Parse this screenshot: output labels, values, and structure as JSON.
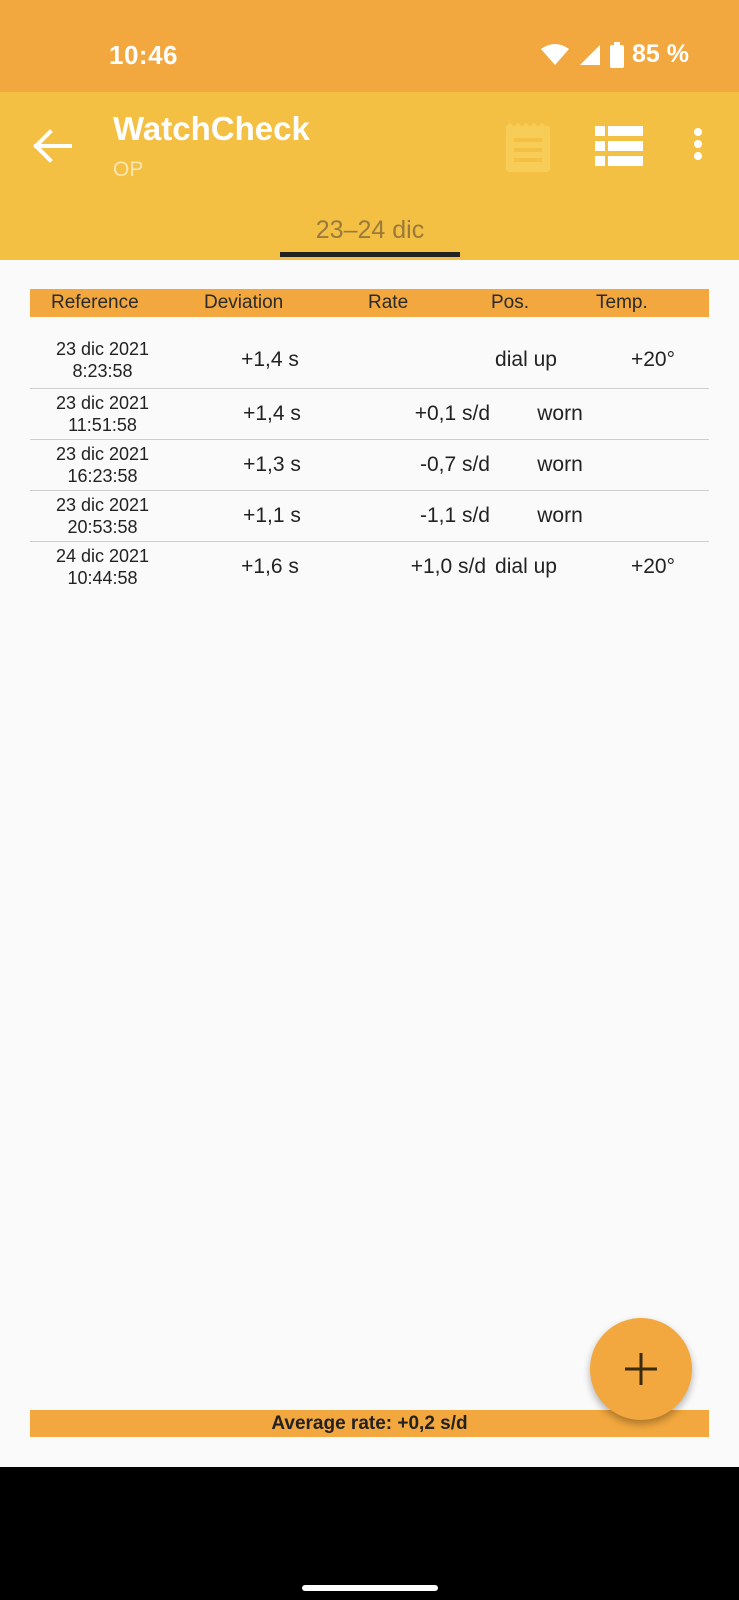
{
  "status_bar": {
    "time": "10:46",
    "battery": "85 %"
  },
  "app_bar": {
    "title": "WatchCheck",
    "subtitle": "OP"
  },
  "tab": {
    "label": "23–24 dic"
  },
  "table": {
    "headers": {
      "reference": "Reference",
      "deviation": "Deviation",
      "rate": "Rate",
      "position": "Pos.",
      "temperature": "Temp."
    },
    "rows": [
      {
        "date": "23 dic 2021",
        "time": "8:23:58",
        "deviation": "+1,4 s",
        "rate": "",
        "position": "dial up",
        "temperature": "+20°"
      },
      {
        "date": "23 dic 2021",
        "time": "11:51:58",
        "deviation": "+1,4 s",
        "rate": "+0,1 s/d",
        "position": "worn",
        "temperature": ""
      },
      {
        "date": "23 dic 2021",
        "time": "16:23:58",
        "deviation": "+1,3 s",
        "rate": "-0,7 s/d",
        "position": "worn",
        "temperature": ""
      },
      {
        "date": "23 dic 2021",
        "time": "20:53:58",
        "deviation": "+1,1 s",
        "rate": "-1,1 s/d",
        "position": "worn",
        "temperature": ""
      },
      {
        "date": "24 dic 2021",
        "time": "10:44:58",
        "deviation": "+1,6 s",
        "rate": "+1,0 s/d",
        "position": "dial up",
        "temperature": "+20°"
      }
    ]
  },
  "footer": {
    "average_rate": "Average rate: +0,2 s/d"
  },
  "colors": {
    "status_bar": "#f2a83e",
    "app_bar": "#f4c043",
    "accent": "#f2a83e"
  },
  "icons": {
    "back": "arrow-left-icon",
    "notes": "notepad-icon",
    "list": "list-icon",
    "more": "more-vert-icon",
    "add": "plus-icon"
  }
}
